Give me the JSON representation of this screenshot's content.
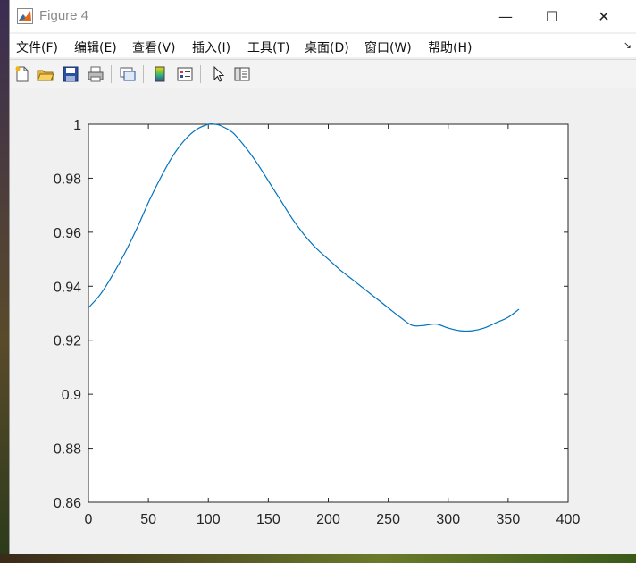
{
  "window": {
    "title": "Figure 4",
    "minimize_symbol": "—",
    "maximize_symbol": "☐",
    "close_symbol": "✕"
  },
  "menu": {
    "items": [
      "文件(F)",
      "编辑(E)",
      "查看(V)",
      "插入(I)",
      "工具(T)",
      "桌面(D)",
      "窗口(W)",
      "帮助(H)"
    ],
    "corner_symbol": "↘"
  },
  "toolbar": {
    "icons": [
      "new-figure-icon",
      "open-file-icon",
      "save-icon",
      "print-icon",
      "link-plot-icon",
      "colorbar-icon",
      "legend-icon",
      "pointer-icon",
      "property-editor-icon"
    ]
  },
  "colors": {
    "line": "#0072bd",
    "axes_bg": "#ffffff",
    "figure_bg": "#f0f0f0"
  },
  "chart_data": {
    "type": "line",
    "title": "",
    "xlabel": "",
    "ylabel": "",
    "xlim": [
      0,
      400
    ],
    "ylim": [
      0.86,
      1
    ],
    "xticks": [
      "0",
      "50",
      "100",
      "150",
      "200",
      "250",
      "300",
      "350",
      "400"
    ],
    "yticks": [
      "0.86",
      "0.88",
      "0.9",
      "0.92",
      "0.94",
      "0.96",
      "0.98",
      "1"
    ],
    "grid": false,
    "series": [
      {
        "x": [
          0,
          10,
          20,
          30,
          40,
          50,
          60,
          70,
          80,
          90,
          100,
          105,
          110,
          120,
          130,
          140,
          150,
          160,
          170,
          180,
          190,
          200,
          210,
          220,
          230,
          240,
          250,
          260,
          270,
          280,
          290,
          300,
          310,
          320,
          330,
          340,
          350,
          359
        ],
        "y": [
          0.932,
          0.937,
          0.944,
          0.952,
          0.961,
          0.971,
          0.98,
          0.988,
          0.994,
          0.998,
          1.0,
          1.0,
          0.9995,
          0.997,
          0.992,
          0.986,
          0.979,
          0.972,
          0.965,
          0.959,
          0.954,
          0.95,
          0.946,
          0.9425,
          0.939,
          0.9355,
          0.932,
          0.9285,
          0.9255,
          0.9255,
          0.926,
          0.9245,
          0.9235,
          0.9235,
          0.9245,
          0.9265,
          0.9285,
          0.9315
        ]
      }
    ]
  }
}
